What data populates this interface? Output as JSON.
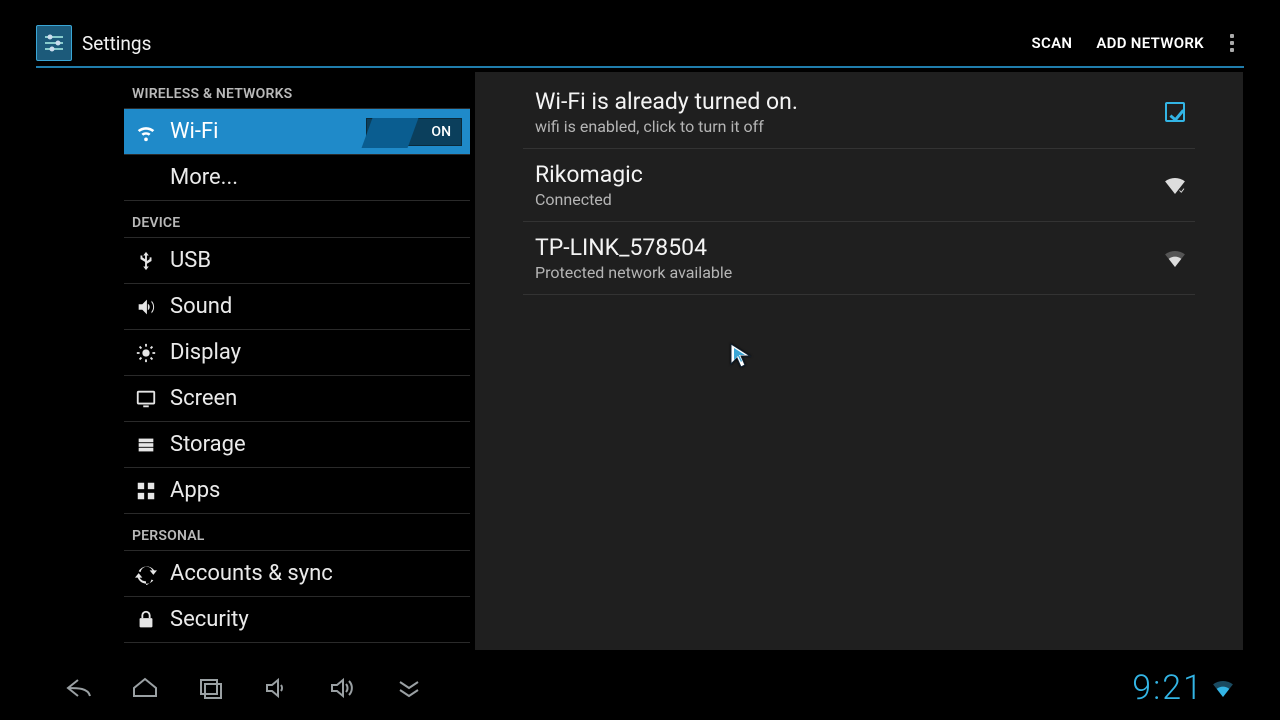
{
  "app": {
    "title": "Settings"
  },
  "actions": {
    "scan": "SCAN",
    "add_network": "ADD NETWORK"
  },
  "sections": {
    "wireless": "WIRELESS & NETWORKS",
    "device": "DEVICE",
    "personal": "PERSONAL"
  },
  "nav": {
    "wifi": "Wi-Fi",
    "wifi_toggle": "ON",
    "more": "More...",
    "usb": "USB",
    "sound": "Sound",
    "display": "Display",
    "screen": "Screen",
    "storage": "Storage",
    "apps": "Apps",
    "accounts": "Accounts & sync",
    "security": "Security"
  },
  "wifi_panel": {
    "status_title": "Wi-Fi is already turned on.",
    "status_sub": "wifi is enabled, click to turn it off",
    "net1_name": "Rikomagic",
    "net1_sub": "Connected",
    "net2_name": "TP-LINK_578504",
    "net2_sub": "Protected network available"
  },
  "statusbar": {
    "time": "9:21"
  }
}
